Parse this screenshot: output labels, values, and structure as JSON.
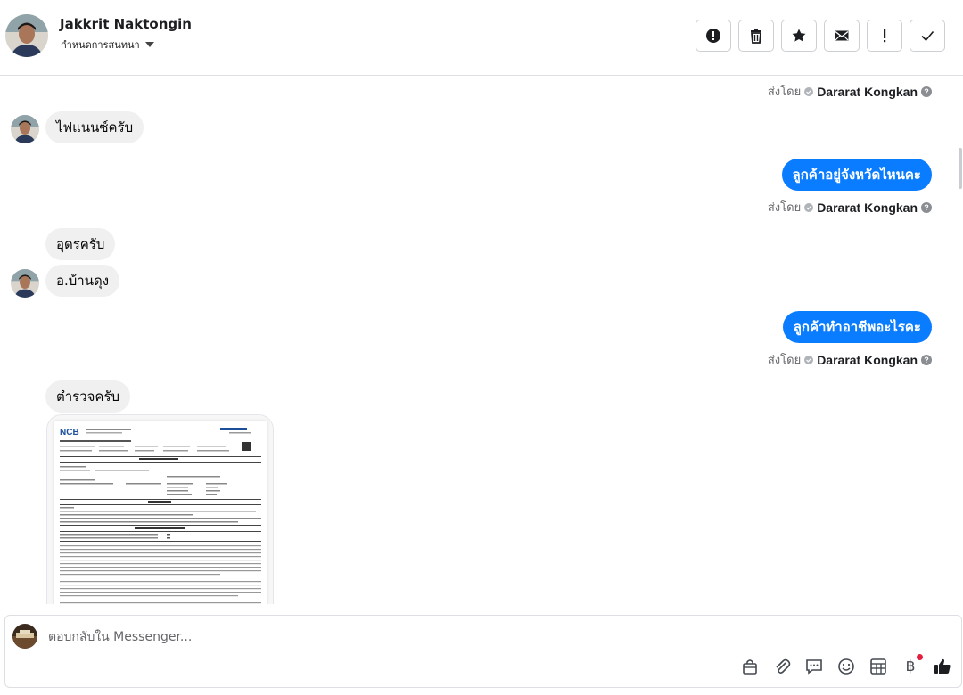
{
  "header": {
    "contact_name": "Jakkrit Naktongin",
    "assign_label": "กำหนดการสนทนา",
    "actions": [
      {
        "name": "spam-button",
        "icon": "alert-circle-icon"
      },
      {
        "name": "delete-button",
        "icon": "trash-icon"
      },
      {
        "name": "star-button",
        "icon": "star-icon"
      },
      {
        "name": "mark-unread-button",
        "icon": "envelope-icon"
      },
      {
        "name": "follow-up-button",
        "icon": "exclamation-icon"
      },
      {
        "name": "mark-done-button",
        "icon": "check-icon"
      }
    ]
  },
  "sent_by": {
    "prefix": "ส่งโดย",
    "agent": "Dararat Kongkan"
  },
  "messages": [
    {
      "direction": "in",
      "text": "ไฟแนนซ์ครับ"
    },
    {
      "direction": "out",
      "text": "ลูกค้าอยู่จังหวัดไหนคะ"
    },
    {
      "direction": "in",
      "text": "อุดรครับ"
    },
    {
      "direction": "in",
      "text": "อ.บ้านดุง"
    },
    {
      "direction": "out",
      "text": "ลูกค้าทำอาชีพอะไรคะ"
    },
    {
      "direction": "in",
      "text": "ตำรวจครับ"
    },
    {
      "direction": "in",
      "type": "image",
      "text": "NCB"
    }
  ],
  "composer": {
    "placeholder": "ตอบกลับใน Messenger...",
    "tools": [
      "shopping-bag-icon",
      "paperclip-icon",
      "saved-reply-icon",
      "emoji-icon",
      "table-icon",
      "baht-icon",
      "thumbs-up-icon"
    ],
    "currency_symbol": "฿"
  },
  "colors": {
    "accent": "#0a7cff",
    "incoming_bubble": "#f0f0f0",
    "notification_dot": "#e41e3f"
  }
}
